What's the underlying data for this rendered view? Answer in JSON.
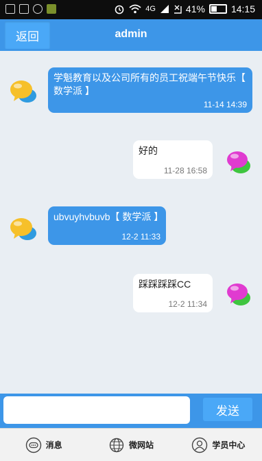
{
  "status_bar": {
    "network": "4G",
    "battery_percent": "41%",
    "time": "14:15"
  },
  "header": {
    "back_label": "返回",
    "title": "admin"
  },
  "messages": [
    {
      "direction": "in",
      "text": "学魁教育以及公司所有的员工祝端午节快乐【 数学派 】",
      "time": "11-14 14:39"
    },
    {
      "direction": "out",
      "text": "好的",
      "time": "11-28 16:58"
    },
    {
      "direction": "in",
      "text": "ubvuyhvbuvb【 数学派 】",
      "time": "12-2 11:33"
    },
    {
      "direction": "out",
      "text": "踩踩踩踩CC",
      "time": "12-2 11:34"
    }
  ],
  "composer": {
    "value": "",
    "send_label": "发送"
  },
  "bottom_nav": [
    {
      "label": "消息",
      "icon": "message-icon"
    },
    {
      "label": "微网站",
      "icon": "globe-icon"
    },
    {
      "label": "学员中心",
      "icon": "user-icon"
    }
  ],
  "colors": {
    "brand": "#3d96e8",
    "chat_background": "#e9eef3",
    "incoming_avatar": "#f6c02a",
    "outgoing_avatar": "#e03bd0"
  }
}
